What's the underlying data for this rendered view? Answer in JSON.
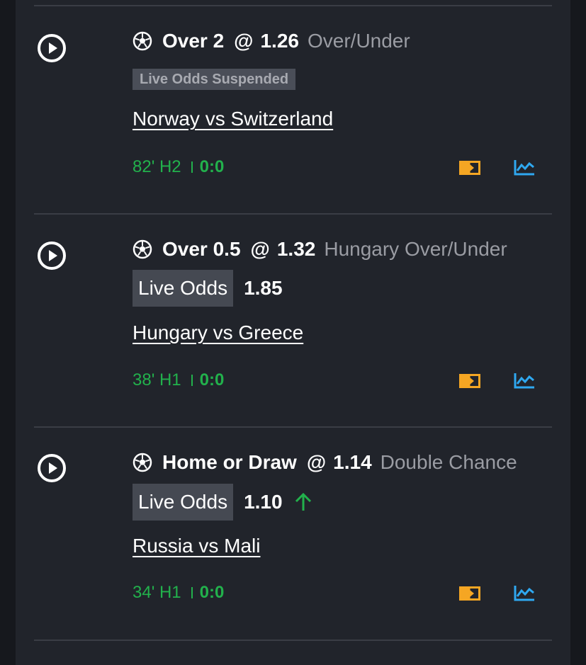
{
  "bets": [
    {
      "selection": "Over 2",
      "at": "@",
      "price": "1.26",
      "market": "Over/Under",
      "suspended_label": "Live Odds Suspended",
      "match": "Norway vs Switzerland",
      "time": "82' H2",
      "score": "0:0"
    },
    {
      "selection": "Over 0.5",
      "at": "@",
      "price": "1.32",
      "market": "Hungary Over/Under",
      "live_label": "Live Odds",
      "live_value": "1.85",
      "match": "Hungary vs Greece",
      "time": "38' H1",
      "score": "0:0"
    },
    {
      "selection": "Home or Draw",
      "at": "@",
      "price": "1.14",
      "market": "Double Chance",
      "live_label": "Live Odds",
      "live_value": "1.10",
      "live_trend": "up",
      "match": "Russia vs Mali",
      "time": "34' H1",
      "score": "0:0"
    }
  ],
  "icons": {
    "play": "play-circle-icon",
    "sport": "soccer-ball-icon",
    "stream": "live-stream-icon",
    "stats": "stats-chart-icon",
    "trend": "arrow-up-icon"
  },
  "colors": {
    "panel": "#21242b",
    "live_green": "#22b14c",
    "stream_orange": "#f5a623",
    "stats_blue": "#2fa8f0",
    "muted": "#9a9ca3"
  }
}
